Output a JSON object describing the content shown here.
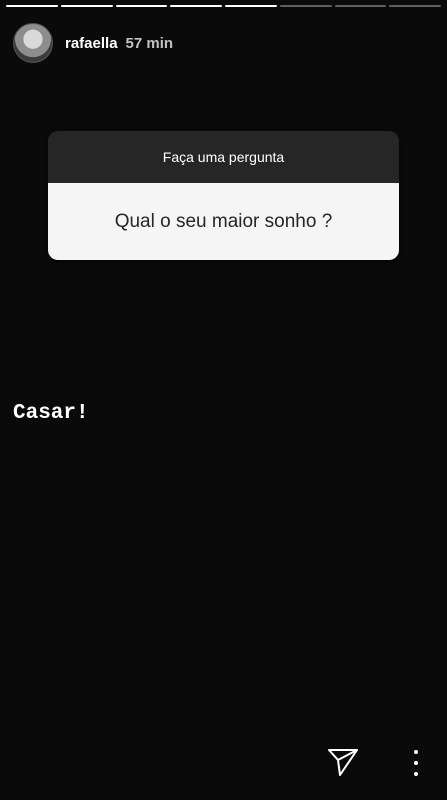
{
  "story": {
    "progress": {
      "total_segments": 8,
      "seen_segments": 5
    },
    "username": "rafaella",
    "time_ago": "57 min"
  },
  "question_sticker": {
    "header": "Faça uma pergunta",
    "question": "Qual o seu maior sonho ?"
  },
  "answer_text": "Casar!",
  "actions": {
    "send_icon": "paper-plane-icon",
    "more_icon": "vertical-ellipsis-icon"
  },
  "colors": {
    "background": "#0a0a0a",
    "sticker_header": "#262626",
    "sticker_body": "#f5f5f5",
    "text_light": "#ffffff"
  }
}
